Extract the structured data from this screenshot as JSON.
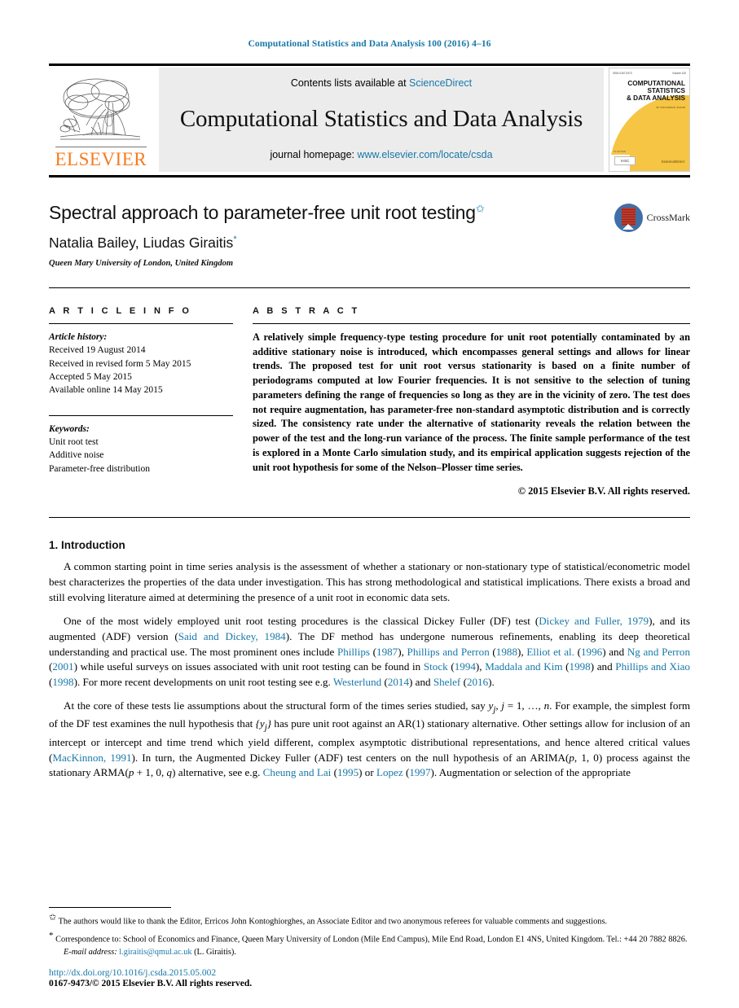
{
  "running_head": "Computational Statistics and Data Analysis 100 (2016) 4–16",
  "banner": {
    "publisher_name": "ELSEVIER",
    "contents_prefix": "Contents lists available at ",
    "contents_link": "ScienceDirect",
    "journal_title": "Computational Statistics and Data Analysis",
    "homepage_prefix": "journal homepage: ",
    "homepage_url": "www.elsevier.com/locate/csda",
    "cover": {
      "line1": "COMPUTATIONAL",
      "line2": "STATISTICS",
      "line3": "& DATA ANALYSIS",
      "subtitle": "An International Journal",
      "badge": "IASC",
      "sciencedirect": "ScienceDirect",
      "hdr_left": "ISSN 0167-9473",
      "hdr_right": "Volume 100"
    }
  },
  "title": {
    "text": "Spectral approach to parameter-free unit root testing",
    "footnote_mark": "✩"
  },
  "authors": {
    "names": "Natalia Bailey, Liudas Giraitis",
    "corresponding_mark": "*",
    "affiliation": "Queen Mary University of London, United Kingdom"
  },
  "crossmark": {
    "label": "CrossMark"
  },
  "article_info": {
    "heading": "A R T I C L E   I N F O",
    "history_label": "Article history:",
    "history": [
      "Received 19 August 2014",
      "Received in revised form 5 May 2015",
      "Accepted 5 May 2015",
      "Available online 14 May 2015"
    ],
    "keywords_label": "Keywords:",
    "keywords": [
      "Unit root test",
      "Additive noise",
      "Parameter-free distribution"
    ]
  },
  "abstract": {
    "heading": "A B S T R A C T",
    "text": "A relatively simple frequency-type testing procedure for unit root potentially contaminated by an additive stationary noise is introduced, which encompasses general settings and allows for linear trends. The proposed test for unit root versus stationarity is based on a finite number of periodograms computed at low Fourier frequencies. It is not sensitive to the selection of tuning parameters defining the range of frequencies so long as they are in the vicinity of zero. The test does not require augmentation, has parameter-free non-standard asymptotic distribution and is correctly sized. The consistency rate under the alternative of stationarity reveals the relation between the power of the test and the long-run variance of the process. The finite sample performance of the test is explored in a Monte Carlo simulation study, and its empirical application suggests rejection of the unit root hypothesis for some of the Nelson–Plosser time series.",
    "copyright": "© 2015 Elsevier B.V. All rights reserved."
  },
  "section": {
    "number_title": "1.  Introduction"
  },
  "paragraphs": {
    "p1": "A common starting point in time series analysis is the assessment of whether a stationary or non-stationary type of statistical/econometric model best characterizes the properties of the data under investigation. This has strong methodological and statistical implications. There exists a broad and still evolving literature aimed at determining the presence of a unit root in economic data sets."
  },
  "citations": {
    "dickey_fuller": "Dickey and Fuller, 1979",
    "said_dickey": "Said and Dickey, 1984",
    "phillips": "Phillips",
    "phillips_year": "1987",
    "phillips_perron": "Phillips and Perron",
    "phillips_perron_year": "1988",
    "elliot": "Elliot et al.",
    "elliot_year": "1996",
    "ng_perron": "Ng and Perron",
    "ng_perron_year": "2001",
    "stock": "Stock",
    "stock_year": "1994",
    "maddala_kim": "Maddala and Kim",
    "maddala_kim_year": "1998",
    "phillips_xiao": "Phillips and Xiao",
    "phillips_xiao_year": "1998",
    "westerlund": "Westerlund",
    "westerlund_year": "2014",
    "shelef": "Shelef",
    "shelef_year": "2016",
    "mackinnon": "MacKinnon, 1991",
    "cheung_lai": "Cheung and Lai",
    "cheung_lai_year": "1995",
    "lopez": "Lopez",
    "lopez_year": "1997"
  },
  "footnotes": {
    "acknowledgment_mark": "✩",
    "acknowledgment": "The authors would like to thank the Editor, Erricos John Kontoghiorghes, an Associate Editor and two anonymous referees for valuable comments and suggestions.",
    "correspondence_mark": "*",
    "correspondence": "Correspondence to: School of Economics and Finance, Queen Mary University of London (Mile End Campus), Mile End Road, London E1 4NS, United Kingdom. Tel.: +44 20 7882 8826.",
    "email_label": "E-mail address:",
    "email": "l.giraitis@qmul.ac.uk",
    "email_suffix": "(L. Giraitis).",
    "doi": "http://dx.doi.org/10.1016/j.csda.2015.05.002",
    "issn_line": "0167-9473/© 2015 Elsevier B.V. All rights reserved."
  },
  "colors": {
    "link": "#1878a8",
    "elsevier_orange": "#f57c20",
    "banner_gray": "#ececec",
    "cover_yellow": "#f6c544"
  }
}
